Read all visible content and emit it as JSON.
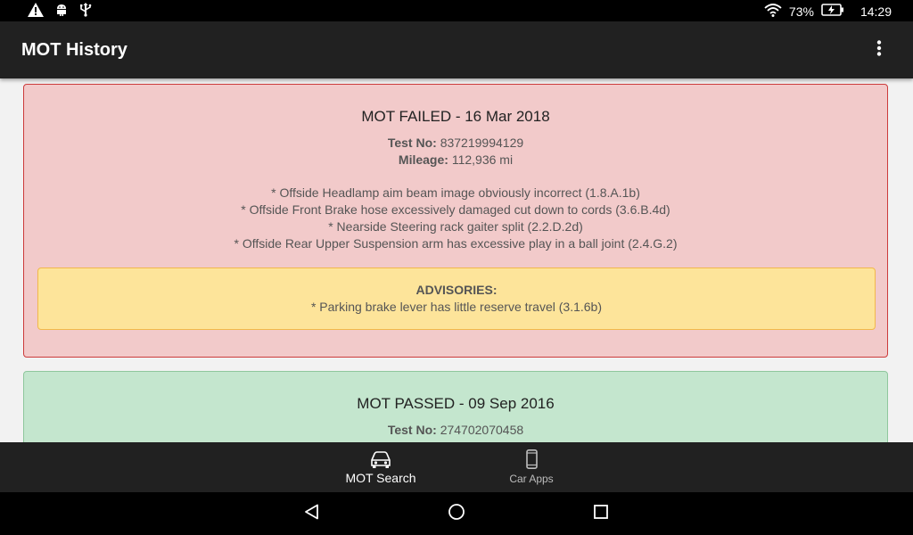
{
  "status_bar": {
    "icons": [
      "warning-icon",
      "android-icon",
      "usb-icon"
    ],
    "wifi_icon": "wifi-icon",
    "battery_percent": "73%",
    "battery_icon": "battery-charging-icon",
    "time": "14:29"
  },
  "app_bar": {
    "title": "MOT History",
    "overflow_icon": "more-vert-icon"
  },
  "records": [
    {
      "title": "MOT FAILED - 16 Mar 2018",
      "test_no_label": "Test No:",
      "test_no": "837219994129",
      "mileage_label": "Mileage:",
      "mileage": "112,936 mi",
      "defects": [
        "* Offside Headlamp aim beam image obviously incorrect (1.8.A.1b)",
        "* Offside Front Brake hose excessively damaged cut down to cords (3.6.B.4d)",
        "* Nearside Steering rack gaiter split (2.2.D.2d)",
        "* Offside Rear Upper Suspension arm has excessive play in a ball joint (2.4.G.2)"
      ],
      "advisories_label": "ADVISORIES:",
      "advisories": [
        "* Parking brake lever has little reserve travel (3.1.6b)"
      ]
    },
    {
      "title": "MOT PASSED - 09 Sep 2016",
      "test_no_label": "Test No:",
      "test_no": "274702070458"
    }
  ],
  "bottom_nav": {
    "items": [
      {
        "label": "MOT Search",
        "icon": "car-icon",
        "selected": true
      },
      {
        "label": "Car Apps",
        "icon": "phone-icon",
        "selected": false
      }
    ]
  },
  "system_nav": {
    "back_icon": "back-icon",
    "home_icon": "home-icon",
    "recents_icon": "recents-icon"
  },
  "colors": {
    "failed_bg": "#f2caca",
    "failed_border": "#cc3b3b",
    "passed_bg": "#c4e6ce",
    "advisory_bg": "#fde49a",
    "app_bar": "#212121"
  }
}
